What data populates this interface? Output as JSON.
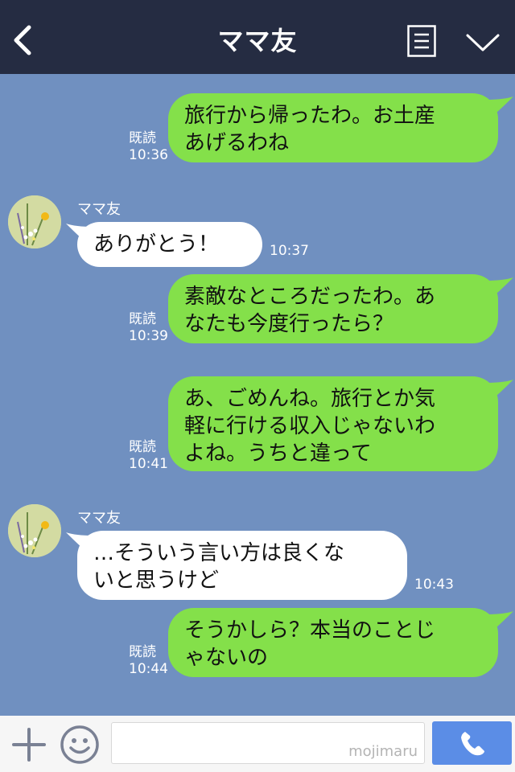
{
  "header": {
    "title": "ママ友"
  },
  "messages": [
    {
      "side": "sent",
      "text": "旅行から帰ったわ。お土産\nあげるわね",
      "read": "既読",
      "time": "10:36"
    },
    {
      "side": "recv",
      "sender": "ママ友",
      "text": "ありがとう！",
      "time": "10:37"
    },
    {
      "side": "sent",
      "text": "素敵なところだったわ。あ\nなたも今度行ったら？",
      "read": "既読",
      "time": "10:39"
    },
    {
      "side": "sent",
      "text": "あ、ごめんね。旅行とか気\n軽に行ける収入じゃないわ\nよね。うちと違って",
      "read": "既読",
      "time": "10:41"
    },
    {
      "side": "recv",
      "sender": "ママ友",
      "text": "…そういう言い方は良くな\nいと思うけど",
      "time": "10:43"
    },
    {
      "side": "sent",
      "text": "そうかしら？本当のことじ\nゃないの",
      "read": "既読",
      "time": "10:44"
    }
  ],
  "input": {
    "watermark": "mojimaru"
  },
  "icons": [
    "back-icon",
    "menu-icon",
    "chevron-down-icon",
    "plus-icon",
    "smile-icon",
    "phone-icon"
  ],
  "colors": {
    "header": "#252c42",
    "background": "#7090c0",
    "sent_bubble": "#84e04a",
    "recv_bubble": "#ffffff",
    "call_button": "#5b8de6"
  }
}
